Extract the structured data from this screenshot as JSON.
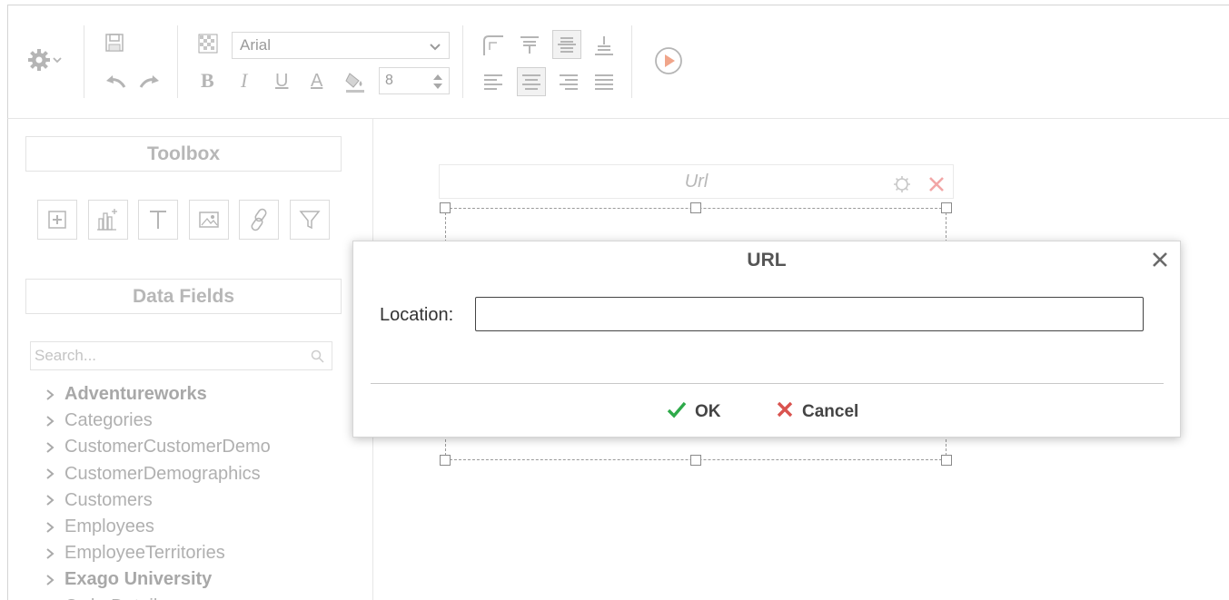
{
  "toolbar": {
    "font_name": "Arial",
    "font_size": "8",
    "bold_label": "B",
    "italic_label": "I",
    "underline_label": "U",
    "font_color_label": "A",
    "icons": [
      "gear-icon",
      "save-icon",
      "undo-icon",
      "redo-icon",
      "checkerboard-icon",
      "paint-bucket-icon",
      "border-corner-icon",
      "valign-top-icon",
      "valign-middle-icon",
      "valign-bottom-icon",
      "align-left-icon",
      "align-center-icon",
      "align-right-icon",
      "align-justify-icon",
      "play-icon"
    ]
  },
  "left_panel": {
    "toolbox_title": "Toolbox",
    "toolbox_buttons": [
      "add-icon",
      "chart-icon",
      "text-icon",
      "image-icon",
      "link-icon",
      "filter-icon"
    ],
    "data_fields_title": "Data Fields",
    "search_placeholder": "Search...",
    "tree": [
      {
        "label": "Adventureworks",
        "bold": true
      },
      {
        "label": "Categories",
        "bold": false
      },
      {
        "label": "CustomerCustomerDemo",
        "bold": false
      },
      {
        "label": "CustomerDemographics",
        "bold": false
      },
      {
        "label": "Customers",
        "bold": false
      },
      {
        "label": "Employees",
        "bold": false
      },
      {
        "label": "EmployeeTerritories",
        "bold": false
      },
      {
        "label": "Exago University",
        "bold": true
      },
      {
        "label": "OrderDetails",
        "bold": false
      }
    ]
  },
  "canvas": {
    "widget_title": "Url"
  },
  "dialog": {
    "title": "URL",
    "location_label": "Location:",
    "location_value": "",
    "ok_label": "OK",
    "cancel_label": "Cancel"
  },
  "colors": {
    "ok_green": "#2eaa4a",
    "cancel_red": "#d9534f",
    "icon_grey": "#b5b5b5",
    "play_orange": "#f0a58a"
  }
}
